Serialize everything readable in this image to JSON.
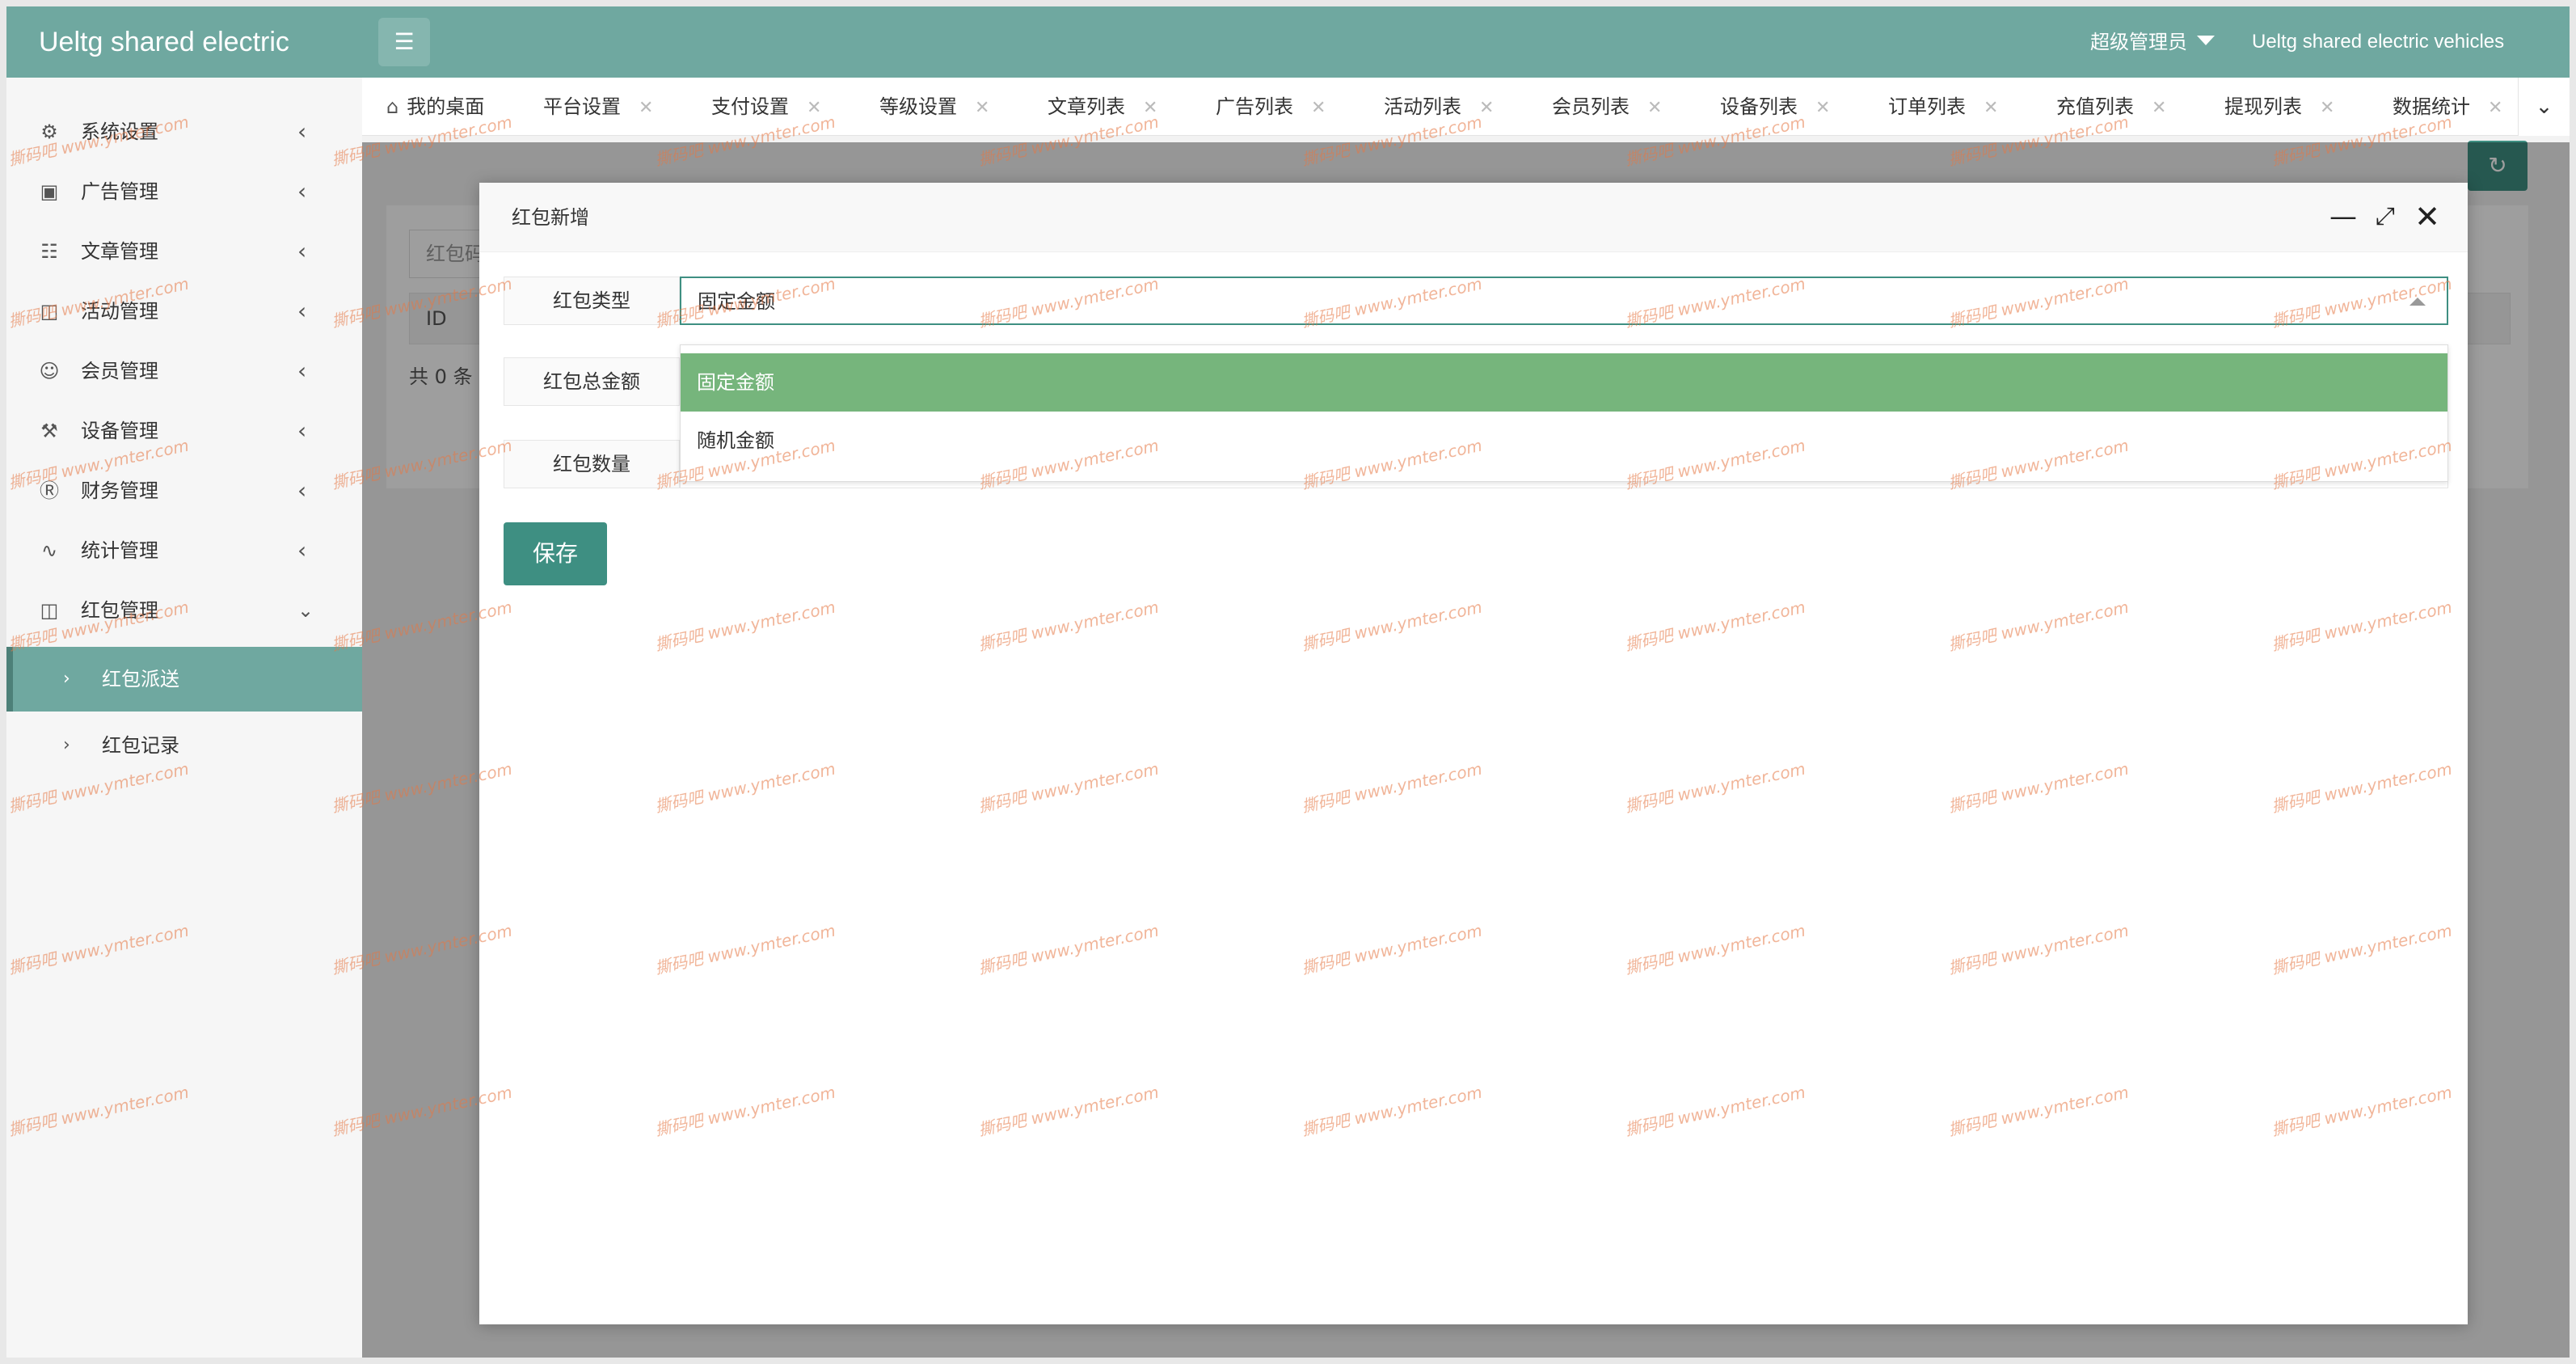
{
  "header": {
    "brand": "Ueltg shared electric",
    "menu_toggle_icon": "list-icon",
    "user": "超级管理员",
    "app_name": "Ueltg shared electric vehicles"
  },
  "sidebar": {
    "items": [
      {
        "label": "系统设置",
        "icon": "gear-icon"
      },
      {
        "label": "广告管理",
        "icon": "image-icon"
      },
      {
        "label": "文章管理",
        "icon": "book-icon"
      },
      {
        "label": "活动管理",
        "icon": "gift-icon"
      },
      {
        "label": "会员管理",
        "icon": "user-icon"
      },
      {
        "label": "设备管理",
        "icon": "tools-icon"
      },
      {
        "label": "财务管理",
        "icon": "dollar-icon"
      },
      {
        "label": "统计管理",
        "icon": "pulse-icon"
      },
      {
        "label": "红包管理",
        "icon": "gift-icon"
      }
    ],
    "subitems": [
      {
        "label": "红包派送",
        "active": true
      },
      {
        "label": "红包记录",
        "active": false
      }
    ]
  },
  "tabs": [
    {
      "label": "我的桌面",
      "home": true
    },
    {
      "label": "平台设置"
    },
    {
      "label": "支付设置"
    },
    {
      "label": "等级设置"
    },
    {
      "label": "文章列表"
    },
    {
      "label": "广告列表"
    },
    {
      "label": "活动列表"
    },
    {
      "label": "会员列表"
    },
    {
      "label": "设备列表"
    },
    {
      "label": "订单列表"
    },
    {
      "label": "充值列表"
    },
    {
      "label": "提现列表"
    },
    {
      "label": "数据统计"
    }
  ],
  "page": {
    "filter_placeholder": "红包码",
    "table_header_first": "ID",
    "count_text": "共 0 条"
  },
  "modal": {
    "title": "红包新增",
    "fields": {
      "type_label": "红包类型",
      "type_value": "固定金额",
      "total_label": "红包总金额",
      "count_label": "红包数量"
    },
    "dropdown_options": [
      {
        "label": "固定金额",
        "selected": true
      },
      {
        "label": "随机金额",
        "selected": false
      }
    ],
    "save_label": "保存"
  },
  "watermark": "撕码吧 www.ymter.com",
  "colors": {
    "header": "#6fa8a0",
    "accent": "#3e8f82",
    "selected_option": "#76b57c"
  }
}
